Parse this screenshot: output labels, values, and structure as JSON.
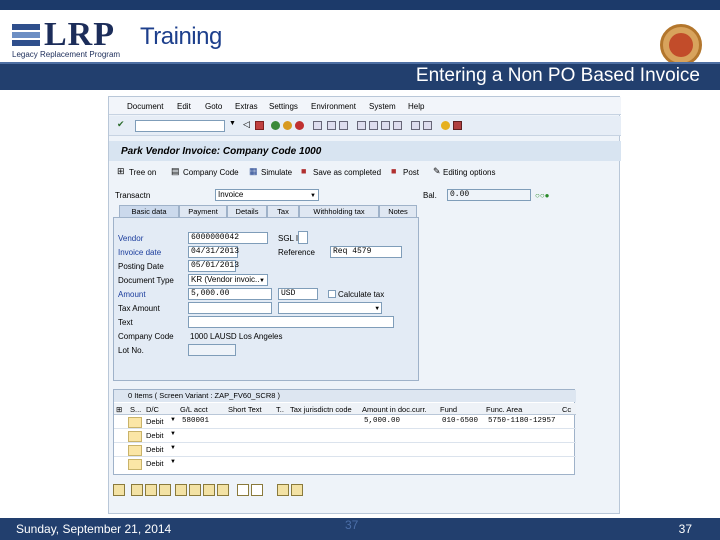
{
  "header": {
    "logo": "LRP",
    "logo_sub": "Legacy Replacement Program",
    "training": "Training",
    "slide_title": "Entering a Non PO Based Invoice"
  },
  "menu": [
    "Document",
    "Edit",
    "Goto",
    "Extras",
    "Settings",
    "Environment",
    "System",
    "Help"
  ],
  "page_title": "Park Vendor Invoice: Company Code 1000",
  "app_toolbar": {
    "tree": "Tree on",
    "company": "Company Code",
    "simulate": "Simulate",
    "save": "Save as completed",
    "post": "Post",
    "editing": "Editing options"
  },
  "transactn": {
    "label": "Transactn",
    "value": "Invoice"
  },
  "bal": {
    "label": "Bal.",
    "value": "0.00"
  },
  "tabs": [
    "Basic data",
    "Payment",
    "Details",
    "Tax",
    "Withholding tax",
    "Notes"
  ],
  "form": {
    "vendor": {
      "label": "Vendor",
      "value": "6000000042"
    },
    "invoice_date": {
      "label": "Invoice date",
      "value": "04/31/2013"
    },
    "posting_date": {
      "label": "Posting Date",
      "value": "05/01/2013"
    },
    "doc_type": {
      "label": "Document Type",
      "value": "KR (Vendor invoic.."
    },
    "amount": {
      "label": "Amount",
      "value": "5,000.00",
      "currency": "USD",
      "calc_tax": "Calculate tax"
    },
    "tax_amount": {
      "label": "Tax Amount"
    },
    "text": {
      "label": "Text"
    },
    "company_code": {
      "label": "Company Code",
      "value": "1000 LAUSD Los Angeles"
    },
    "lot_no": {
      "label": "Lot No."
    },
    "sgl_ind": {
      "label": "SGL Ind"
    },
    "reference": {
      "label": "Reference",
      "value": "Req 4579"
    }
  },
  "grid": {
    "title": "0 Items ( Screen Variant : ZAP_FV60_SCR8 )",
    "headers": [
      "S...",
      "D/C",
      "G/L acct",
      "Short Text",
      "T..",
      "Tax jurisdictn code",
      "Amount in doc.curr.",
      "Fund",
      "Func. Area",
      "Cc"
    ],
    "rows": [
      {
        "dc": "Debit",
        "gl": "580001",
        "amount": "5,000.00",
        "fund": "010-6500",
        "func": "5750-1180-12957"
      },
      {
        "dc": "Debit"
      },
      {
        "dc": "Debit"
      },
      {
        "dc": "Debit"
      }
    ]
  },
  "footer": {
    "date": "Sunday, September 21, 2014",
    "page_center": "37",
    "page_right": "37"
  }
}
